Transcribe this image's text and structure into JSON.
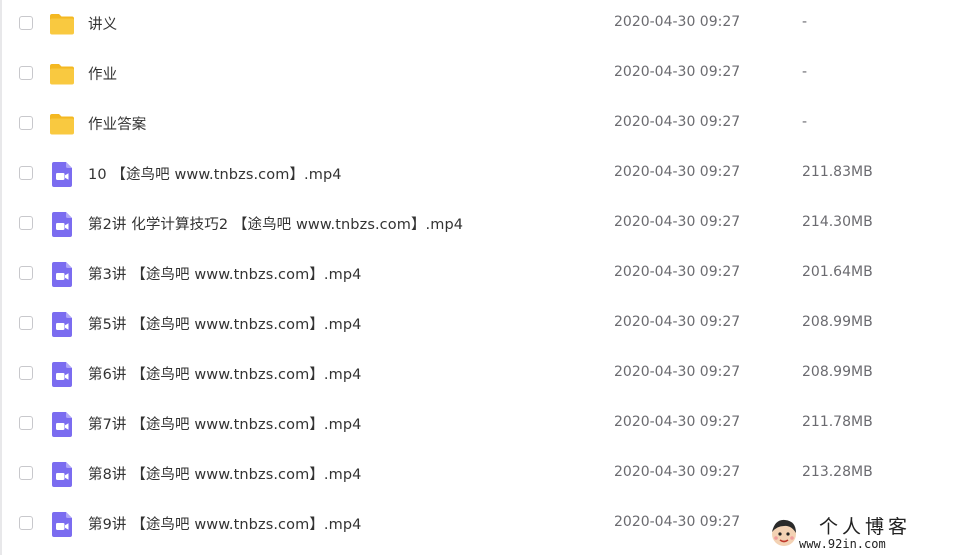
{
  "files": [
    {
      "type": "folder",
      "icon": "folder-icon",
      "name": "讲义",
      "date": "2020-04-30 09:27",
      "size": "-"
    },
    {
      "type": "folder",
      "icon": "folder-icon",
      "name": "作业",
      "date": "2020-04-30 09:27",
      "size": "-"
    },
    {
      "type": "folder",
      "icon": "folder-icon",
      "name": "作业答案",
      "date": "2020-04-30 09:27",
      "size": "-"
    },
    {
      "type": "video",
      "icon": "video-file-icon",
      "name": "10 【途鸟吧 www.tnbzs.com】.mp4",
      "date": "2020-04-30 09:27",
      "size": "211.83MB"
    },
    {
      "type": "video",
      "icon": "video-file-icon",
      "name": "第2讲 化学计算技巧2 【途鸟吧 www.tnbzs.com】.mp4",
      "date": "2020-04-30 09:27",
      "size": "214.30MB"
    },
    {
      "type": "video",
      "icon": "video-file-icon",
      "name": "第3讲 【途鸟吧 www.tnbzs.com】.mp4",
      "date": "2020-04-30 09:27",
      "size": "201.64MB"
    },
    {
      "type": "video",
      "icon": "video-file-icon",
      "name": "第5讲 【途鸟吧 www.tnbzs.com】.mp4",
      "date": "2020-04-30 09:27",
      "size": "208.99MB"
    },
    {
      "type": "video",
      "icon": "video-file-icon",
      "name": "第6讲 【途鸟吧 www.tnbzs.com】.mp4",
      "date": "2020-04-30 09:27",
      "size": "208.99MB"
    },
    {
      "type": "video",
      "icon": "video-file-icon",
      "name": "第7讲 【途鸟吧 www.tnbzs.com】.mp4",
      "date": "2020-04-30 09:27",
      "size": "211.78MB"
    },
    {
      "type": "video",
      "icon": "video-file-icon",
      "name": "第8讲 【途鸟吧 www.tnbzs.com】.mp4",
      "date": "2020-04-30 09:27",
      "size": "213.28MB"
    },
    {
      "type": "video",
      "icon": "video-file-icon",
      "name": "第9讲 【途鸟吧 www.tnbzs.com】.mp4",
      "date": "2020-04-30 09:27",
      "size": ""
    }
  ],
  "colors": {
    "folder": "#f9c940",
    "folder_tab": "#f4b821",
    "video": "#7b6cf0",
    "text": "#333333",
    "meta_text": "#6b6b70"
  },
  "watermark": {
    "title": "个人博客",
    "url": "www.92in.com"
  }
}
